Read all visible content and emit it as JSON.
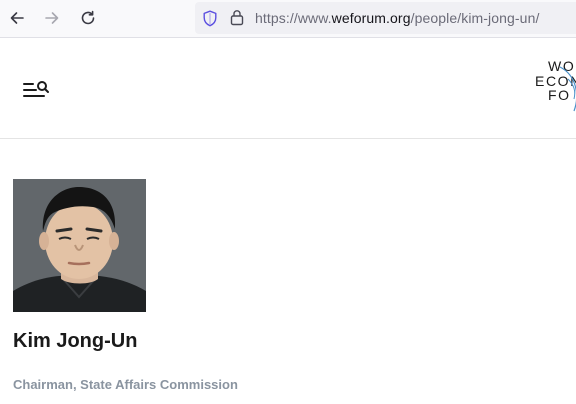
{
  "browser": {
    "url_prefix": "https://www.",
    "url_host": "weforum.org",
    "url_path": "/people/kim-jong-un/",
    "icons": {
      "back": "arrow-left-icon",
      "forward": "arrow-right-icon",
      "reload": "reload-icon",
      "tracking": "shield-icon",
      "security": "lock-icon"
    }
  },
  "site": {
    "logo_lines": [
      "WO",
      "ECON",
      "FO"
    ],
    "menu_icon": "menu-search-icon"
  },
  "profile": {
    "name": "Kim Jong-Un",
    "title": "Chairman, State Affairs Commission",
    "photo_icon": "portrait-photo"
  }
}
